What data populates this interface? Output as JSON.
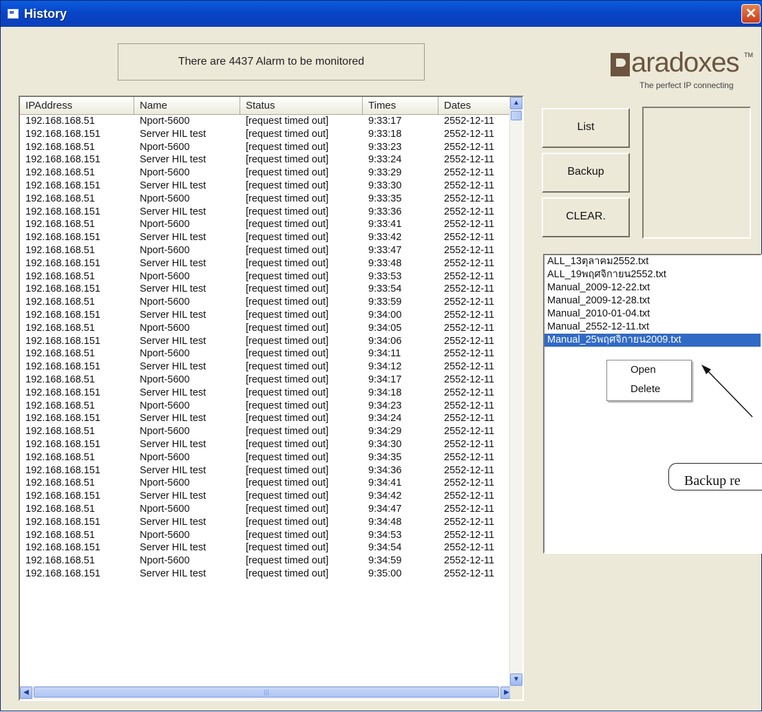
{
  "window": {
    "title": "History",
    "close_label": "✕"
  },
  "alarm_message": "There are 4437 Alarm to be monitored",
  "logo": {
    "word": "aradoxes",
    "tm": "TM",
    "tagline": "The perfect IP connecting"
  },
  "table": {
    "headers": [
      "IPAddress",
      "Name",
      "Status",
      "Times",
      "Dates"
    ],
    "rows": [
      [
        "192.168.168.51",
        "Nport-5600",
        "[request timed out]",
        "9:33:17",
        "2552-12-11"
      ],
      [
        "192.168.168.151",
        "Server HIL test",
        "[request timed out]",
        "9:33:18",
        "2552-12-11"
      ],
      [
        "192.168.168.51",
        "Nport-5600",
        "[request timed out]",
        "9:33:23",
        "2552-12-11"
      ],
      [
        "192.168.168.151",
        "Server HIL test",
        "[request timed out]",
        "9:33:24",
        "2552-12-11"
      ],
      [
        "192.168.168.51",
        "Nport-5600",
        "[request timed out]",
        "9:33:29",
        "2552-12-11"
      ],
      [
        "192.168.168.151",
        "Server HIL test",
        "[request timed out]",
        "9:33:30",
        "2552-12-11"
      ],
      [
        "192.168.168.51",
        "Nport-5600",
        "[request timed out]",
        "9:33:35",
        "2552-12-11"
      ],
      [
        "192.168.168.151",
        "Server HIL test",
        "[request timed out]",
        "9:33:36",
        "2552-12-11"
      ],
      [
        "192.168.168.51",
        "Nport-5600",
        "[request timed out]",
        "9:33:41",
        "2552-12-11"
      ],
      [
        "192.168.168.151",
        "Server HIL test",
        "[request timed out]",
        "9:33:42",
        "2552-12-11"
      ],
      [
        "192.168.168.51",
        "Nport-5600",
        "[request timed out]",
        "9:33:47",
        "2552-12-11"
      ],
      [
        "192.168.168.151",
        "Server HIL test",
        "[request timed out]",
        "9:33:48",
        "2552-12-11"
      ],
      [
        "192.168.168.51",
        "Nport-5600",
        "[request timed out]",
        "9:33:53",
        "2552-12-11"
      ],
      [
        "192.168.168.151",
        "Server HIL test",
        "[request timed out]",
        "9:33:54",
        "2552-12-11"
      ],
      [
        "192.168.168.51",
        "Nport-5600",
        "[request timed out]",
        "9:33:59",
        "2552-12-11"
      ],
      [
        "192.168.168.151",
        "Server HIL test",
        "[request timed out]",
        "9:34:00",
        "2552-12-11"
      ],
      [
        "192.168.168.51",
        "Nport-5600",
        "[request timed out]",
        "9:34:05",
        "2552-12-11"
      ],
      [
        "192.168.168.151",
        "Server HIL test",
        "[request timed out]",
        "9:34:06",
        "2552-12-11"
      ],
      [
        "192.168.168.51",
        "Nport-5600",
        "[request timed out]",
        "9:34:11",
        "2552-12-11"
      ],
      [
        "192.168.168.151",
        "Server HIL test",
        "[request timed out]",
        "9:34:12",
        "2552-12-11"
      ],
      [
        "192.168.168.51",
        "Nport-5600",
        "[request timed out]",
        "9:34:17",
        "2552-12-11"
      ],
      [
        "192.168.168.151",
        "Server HIL test",
        "[request timed out]",
        "9:34:18",
        "2552-12-11"
      ],
      [
        "192.168.168.51",
        "Nport-5600",
        "[request timed out]",
        "9:34:23",
        "2552-12-11"
      ],
      [
        "192.168.168.151",
        "Server HIL test",
        "[request timed out]",
        "9:34:24",
        "2552-12-11"
      ],
      [
        "192.168.168.51",
        "Nport-5600",
        "[request timed out]",
        "9:34:29",
        "2552-12-11"
      ],
      [
        "192.168.168.151",
        "Server HIL test",
        "[request timed out]",
        "9:34:30",
        "2552-12-11"
      ],
      [
        "192.168.168.51",
        "Nport-5600",
        "[request timed out]",
        "9:34:35",
        "2552-12-11"
      ],
      [
        "192.168.168.151",
        "Server HIL test",
        "[request timed out]",
        "9:34:36",
        "2552-12-11"
      ],
      [
        "192.168.168.51",
        "Nport-5600",
        "[request timed out]",
        "9:34:41",
        "2552-12-11"
      ],
      [
        "192.168.168.151",
        "Server HIL test",
        "[request timed out]",
        "9:34:42",
        "2552-12-11"
      ],
      [
        "192.168.168.51",
        "Nport-5600",
        "[request timed out]",
        "9:34:47",
        "2552-12-11"
      ],
      [
        "192.168.168.151",
        "Server HIL test",
        "[request timed out]",
        "9:34:48",
        "2552-12-11"
      ],
      [
        "192.168.168.51",
        "Nport-5600",
        "[request timed out]",
        "9:34:53",
        "2552-12-11"
      ],
      [
        "192.168.168.151",
        "Server HIL test",
        "[request timed out]",
        "9:34:54",
        "2552-12-11"
      ],
      [
        "192.168.168.51",
        "Nport-5600",
        "[request timed out]",
        "9:34:59",
        "2552-12-11"
      ],
      [
        "192.168.168.151",
        "Server HIL test",
        "[request timed out]",
        "9:35:00",
        "2552-12-11"
      ]
    ]
  },
  "buttons": {
    "list": "List",
    "backup": "Backup",
    "clear": "CLEAR."
  },
  "files": [
    "ALL_13ตุลาคม2552.txt",
    "ALL_19พฤศจิกายน2552.txt",
    "Manual_2009-12-22.txt",
    "Manual_2009-12-28.txt",
    "Manual_2010-01-04.txt",
    "Manual_2552-12-11.txt",
    "Manual_25พฤศจิกายน2009.txt"
  ],
  "selected_file_index": 6,
  "context_menu": {
    "open": "Open",
    "delete": "Delete"
  },
  "callout": "Backup re",
  "icons": {
    "close": "close-icon",
    "scroll_up": "scroll-up-icon",
    "scroll_down": "scroll-down-icon",
    "scroll_left": "scroll-left-icon",
    "scroll_right": "scroll-right-icon"
  }
}
